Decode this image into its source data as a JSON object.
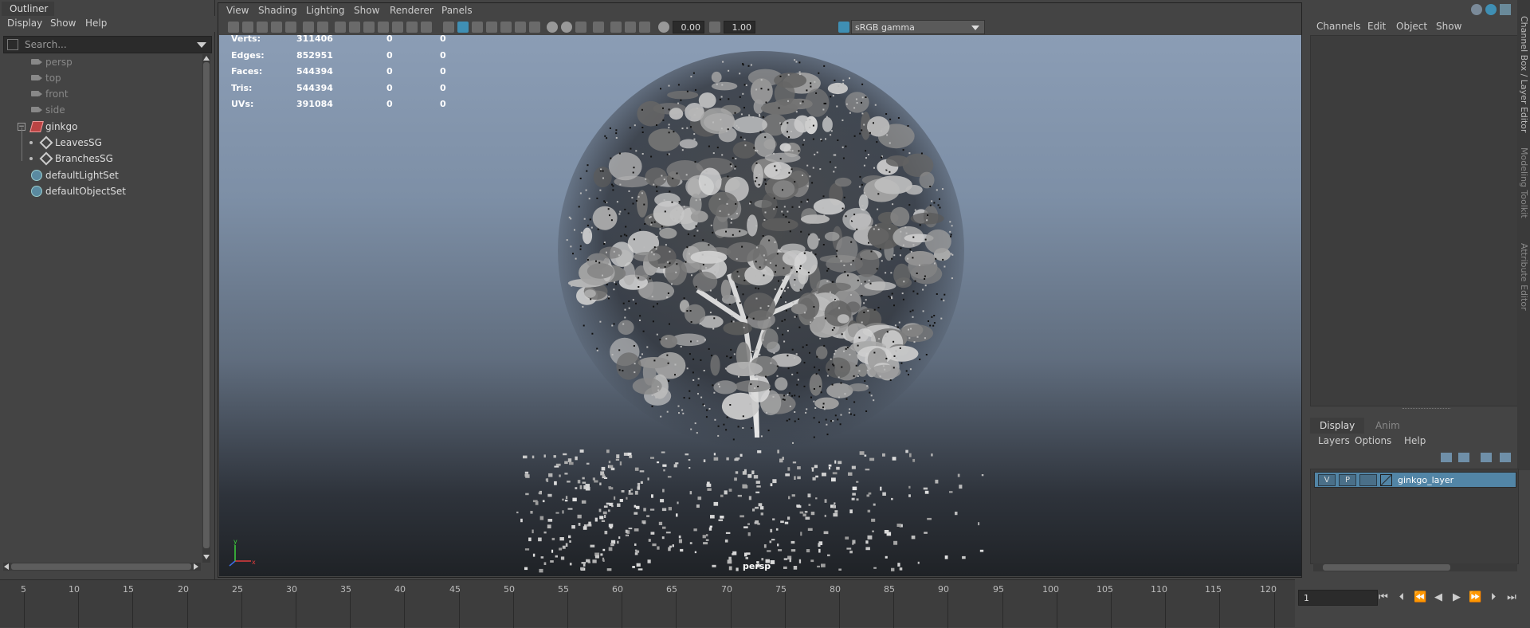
{
  "outliner": {
    "title": "Outliner",
    "menu": [
      "Display",
      "Show",
      "Help"
    ],
    "search_placeholder": "Search...",
    "items": [
      {
        "label": "persp",
        "dim": true
      },
      {
        "label": "top",
        "dim": true
      },
      {
        "label": "front",
        "dim": true
      },
      {
        "label": "side",
        "dim": true
      },
      {
        "label": "ginkgo",
        "dim": false
      },
      {
        "label": "LeavesSG",
        "dim": false
      },
      {
        "label": "BranchesSG",
        "dim": false
      },
      {
        "label": "defaultLightSet",
        "dim": false
      },
      {
        "label": "defaultObjectSet",
        "dim": false
      }
    ]
  },
  "viewport": {
    "menu": [
      "View",
      "Shading",
      "Lighting",
      "Show",
      "Renderer",
      "Panels"
    ],
    "exposure": "0.00",
    "gamma": "1.00",
    "color_space": "sRGB gamma",
    "camera": "persp",
    "hud": [
      {
        "label": "Verts:",
        "v1": "311406",
        "v2": "0",
        "v3": "0"
      },
      {
        "label": "Edges:",
        "v1": "852951",
        "v2": "0",
        "v3": "0"
      },
      {
        "label": "Faces:",
        "v1": "544394",
        "v2": "0",
        "v3": "0"
      },
      {
        "label": "Tris:",
        "v1": "544394",
        "v2": "0",
        "v3": "0"
      },
      {
        "label": "UVs:",
        "v1": "391084",
        "v2": "0",
        "v3": "0"
      }
    ]
  },
  "channel_box": {
    "menu": [
      "Channels",
      "Edit",
      "Object",
      "Show"
    ],
    "side_tabs": [
      "Channel Box / Layer Editor",
      "Modeling Toolkit",
      "Attribute Editor"
    ]
  },
  "layer_editor": {
    "tabs": [
      "Display",
      "Anim"
    ],
    "menu": [
      "Layers",
      "Options",
      "Help"
    ],
    "layer": {
      "v": "V",
      "p": "P",
      "name": "ginkgo_layer"
    }
  },
  "timeline": {
    "ticks": [
      "5",
      "10",
      "15",
      "20",
      "25",
      "30",
      "35",
      "40",
      "45",
      "50",
      "55",
      "60",
      "65",
      "70",
      "75",
      "80",
      "85",
      "90",
      "95",
      "100",
      "105",
      "110",
      "115",
      "120"
    ],
    "current_frame": "1"
  },
  "colors": {
    "accent": "#5285a6",
    "panel": "#444444",
    "viewport_top": "#8b9db5",
    "viewport_bottom": "#1f2226"
  }
}
